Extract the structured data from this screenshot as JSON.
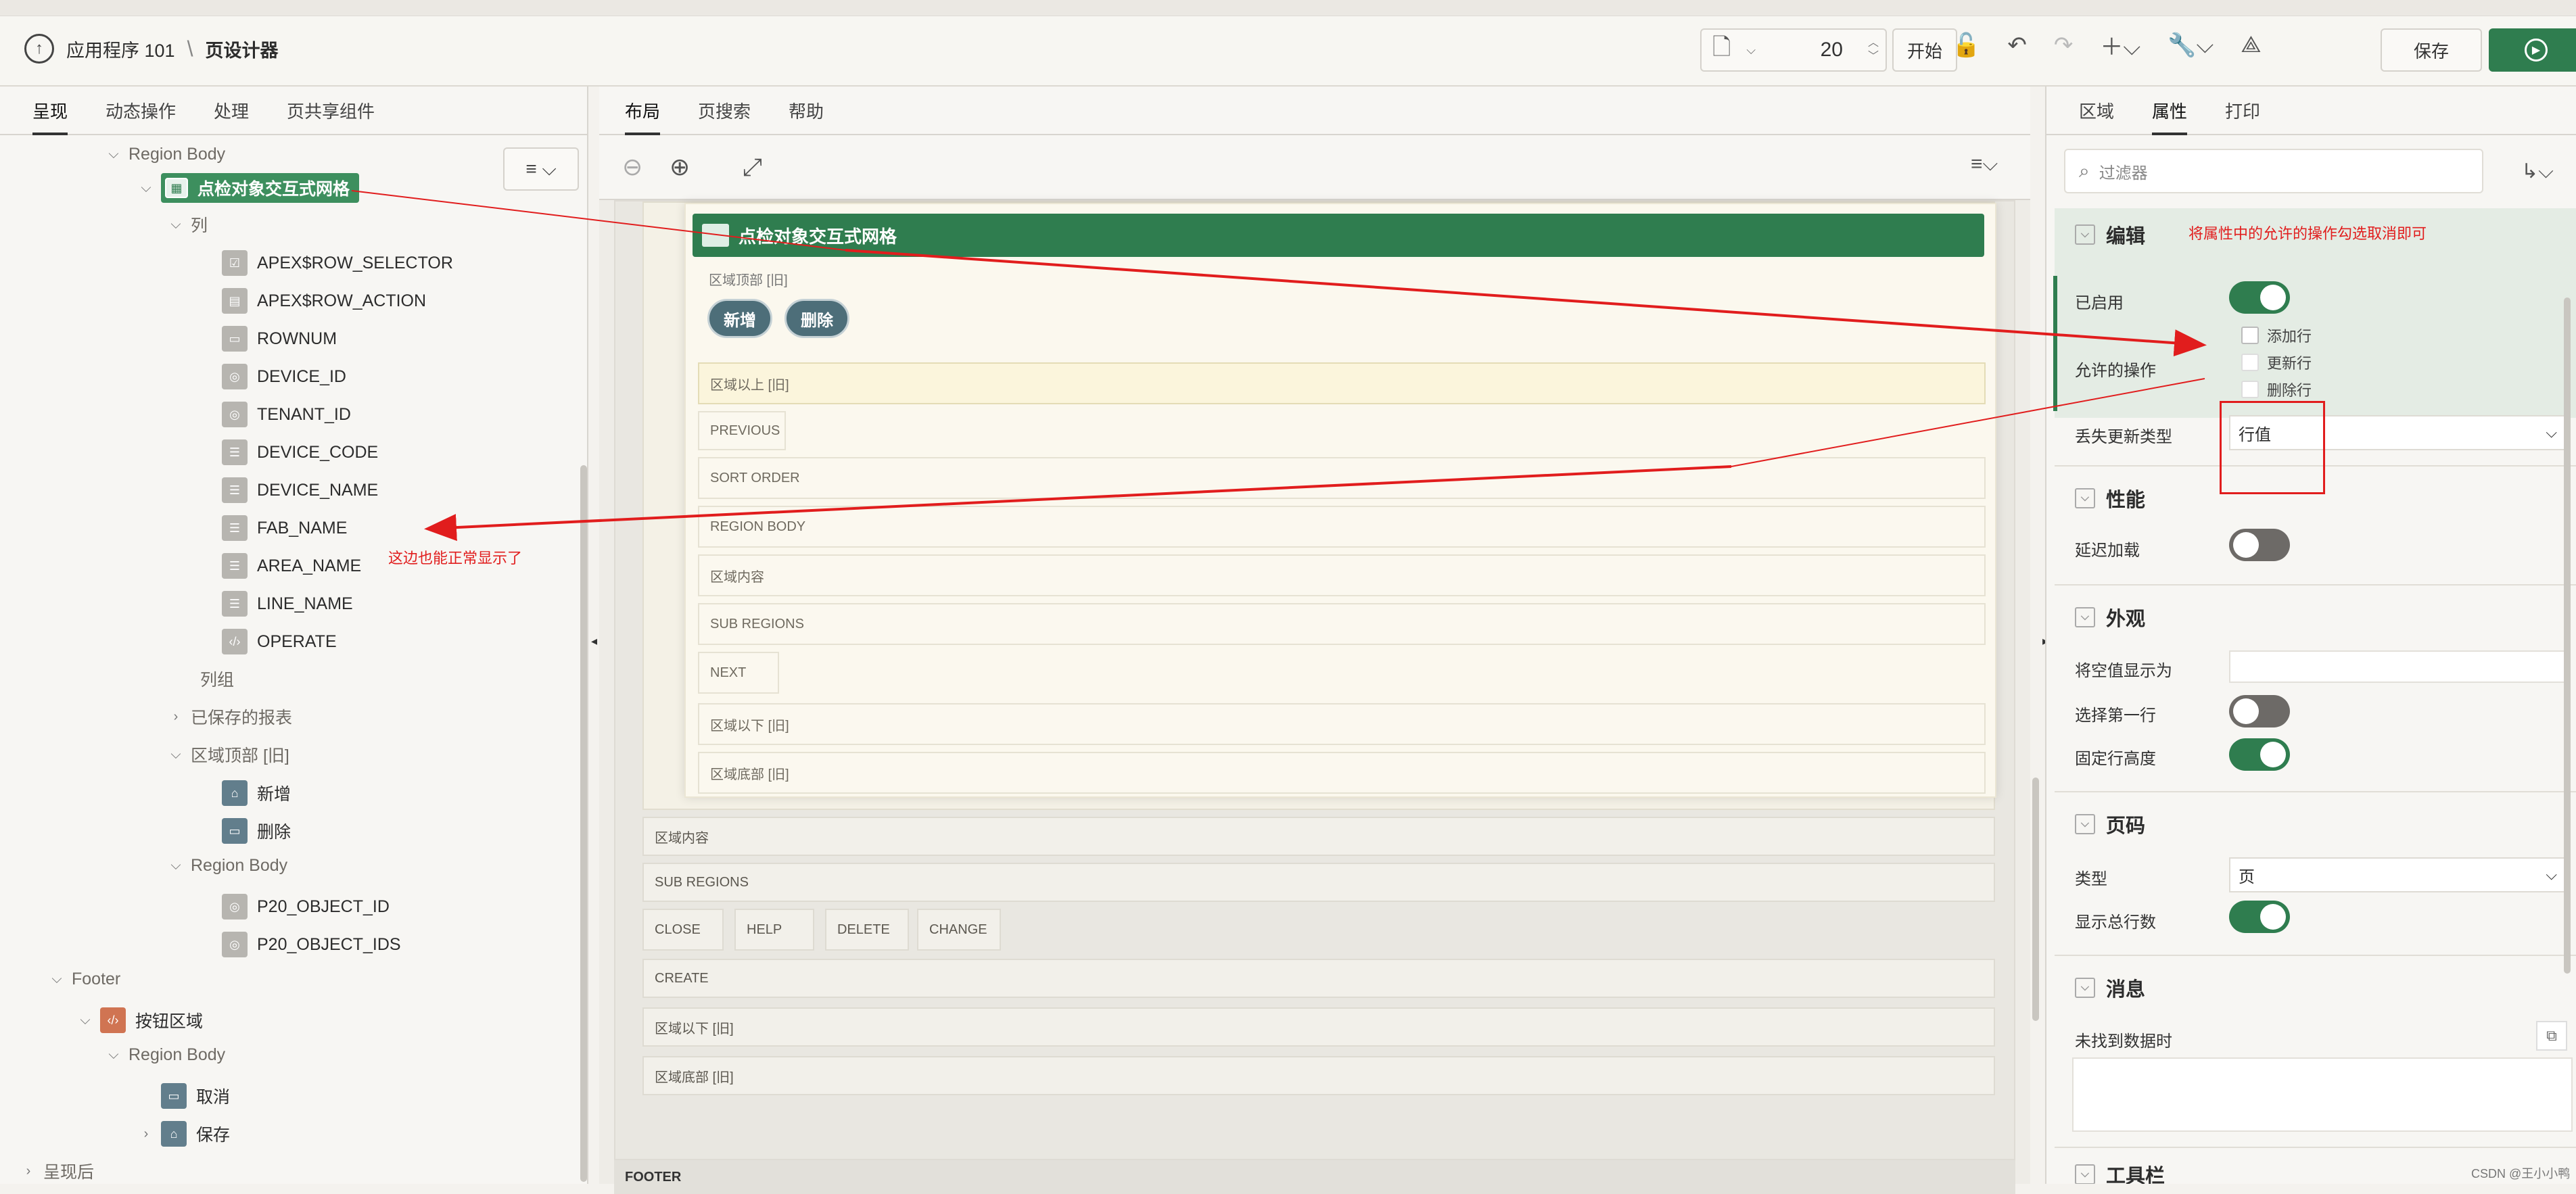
{
  "breadcrumb": {
    "app": "应用程序 101",
    "separator": "\\",
    "current": "页设计器"
  },
  "toolbar": {
    "page_number": "20",
    "go_label": "开始",
    "save_label": "保存"
  },
  "left_tabs": [
    "呈现",
    "动态操作",
    "处理",
    "页共享组件"
  ],
  "tree": {
    "region_body_top": "Region Body",
    "selected_region": "点检对象交互式网格",
    "columns_label": "列",
    "columns": [
      "APEX$ROW_SELECTOR",
      "APEX$ROW_ACTION",
      "ROWNUM",
      "DEVICE_ID",
      "TENANT_ID",
      "DEVICE_CODE",
      "DEVICE_NAME",
      "FAB_NAME",
      "AREA_NAME",
      "LINE_NAME",
      "OPERATE"
    ],
    "column_groups": "列组",
    "saved_reports": "已保存的报表",
    "region_top_legacy": "区域顶部 [旧]",
    "btn_add": "新增",
    "btn_delete": "删除",
    "region_body_2": "Region Body",
    "items": [
      "P20_OBJECT_ID",
      "P20_OBJECT_IDS"
    ],
    "footer": "Footer",
    "button_region": "按钮区域",
    "region_body_3": "Region Body",
    "btn_cancel": "取消",
    "btn_save": "保存",
    "post_render": "呈现后"
  },
  "annotation_left": "这边也能正常显示了",
  "center_tabs": [
    "布局",
    "页搜索",
    "帮助"
  ],
  "layout": {
    "region_title": "点检对象交互式网格",
    "region_top_legacy": "区域顶部 [旧]",
    "btn_add": "新增",
    "btn_delete": "删除",
    "slots": [
      "区域以上 [旧]",
      "PREVIOUS",
      "SORT ORDER",
      "REGION BODY",
      "区域内容",
      "SUB REGIONS",
      "NEXT",
      "区域以下 [旧]",
      "区域底部 [旧]"
    ],
    "outer_slots": [
      "区域内容",
      "SUB REGIONS",
      "CREATE",
      "区域以下 [旧]",
      "区域底部 [旧]"
    ],
    "outer_buttons": [
      "CLOSE",
      "HELP",
      "DELETE",
      "CHANGE"
    ],
    "footer": "FOOTER"
  },
  "right_tabs": [
    "区域",
    "属性",
    "打印"
  ],
  "filter_placeholder": "过滤器",
  "annotation_right": "将属性中的允许的操作勾选取消即可",
  "props": {
    "edit": "编辑",
    "enabled": "已启用",
    "allowed_ops": "允许的操作",
    "op_add": "添加行",
    "op_update": "更新行",
    "op_delete": "删除行",
    "lost_update": "丢失更新类型",
    "lost_update_val": "行值",
    "performance": "性能",
    "lazy_load": "延迟加载",
    "appearance": "外观",
    "show_null_as": "将空值显示为",
    "select_first_row": "选择第一行",
    "fixed_row_height": "固定行高度",
    "pagination": "页码",
    "type": "类型",
    "type_val": "页",
    "show_total": "显示总行数",
    "messages": "消息",
    "no_data": "未找到数据时",
    "toolbar": "工具栏"
  },
  "watermark": "CSDN @王小小鸭",
  "colors": {
    "accent_green": "#2f7d4f",
    "annotation_red": "#e11d1d",
    "button_teal": "#4d6e79"
  }
}
